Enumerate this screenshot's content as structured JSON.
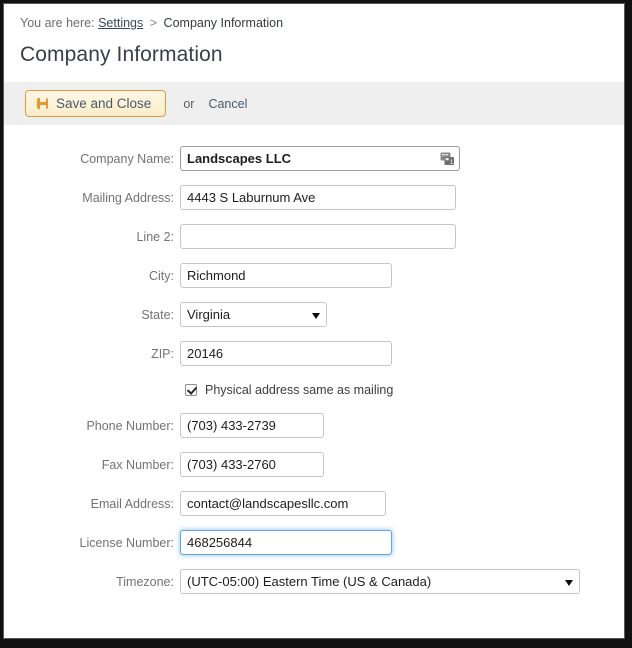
{
  "window": {
    "accent_orange": "#f0932b",
    "focus_blue": "#63a6dd",
    "toolbar_bg": "#efefef"
  },
  "breadcrumb": {
    "prefix": "You are here:",
    "link": "Settings",
    "separator": ">",
    "current": "Company Information"
  },
  "page_title": "Company Information",
  "toolbar": {
    "save_label": "Save and Close",
    "or_label": "or",
    "cancel_label": "Cancel"
  },
  "form": {
    "fields": [
      {
        "name": "company-name",
        "label": "Company Name:",
        "value": "Landscapes LLC",
        "placeholder": "",
        "type": "text",
        "bold": true,
        "icon": "windows-glyph-icon"
      },
      {
        "name": "mailing-address",
        "label": "Mailing Address:",
        "value": "4443 S Laburnum Ave",
        "placeholder": "",
        "type": "text"
      },
      {
        "name": "address-line-2",
        "label": "Line 2:",
        "value": "",
        "placeholder": "",
        "type": "text"
      },
      {
        "name": "city",
        "label": "City:",
        "value": "Richmond",
        "placeholder": "",
        "type": "text"
      },
      {
        "name": "state",
        "label": "State:",
        "value": "Virginia",
        "type": "select",
        "options": [
          "Virginia"
        ]
      },
      {
        "name": "zip",
        "label": "ZIP:",
        "value": "20146",
        "placeholder": "",
        "type": "text"
      },
      {
        "name": "phone-number",
        "label": "Phone Number:",
        "value": "(703) 433-2739",
        "placeholder": "",
        "type": "text"
      },
      {
        "name": "fax-number",
        "label": "Fax Number:",
        "value": "(703) 433-2760",
        "placeholder": "",
        "type": "text"
      },
      {
        "name": "email-address",
        "label": "Email Address:",
        "value": "contact@landscapesllc.com",
        "placeholder": "",
        "type": "text"
      },
      {
        "name": "license-number",
        "label": "License Number:",
        "value": "468256844",
        "placeholder": "",
        "type": "text",
        "focused": true
      },
      {
        "name": "timezone",
        "label": "Timezone:",
        "value": "(UTC-05:00) Eastern Time (US & Canada)",
        "type": "select",
        "options": [
          "(UTC-05:00) Eastern Time (US & Canada)"
        ]
      }
    ],
    "checkbox": {
      "label": "Physical address same as mailing",
      "checked": true
    }
  }
}
